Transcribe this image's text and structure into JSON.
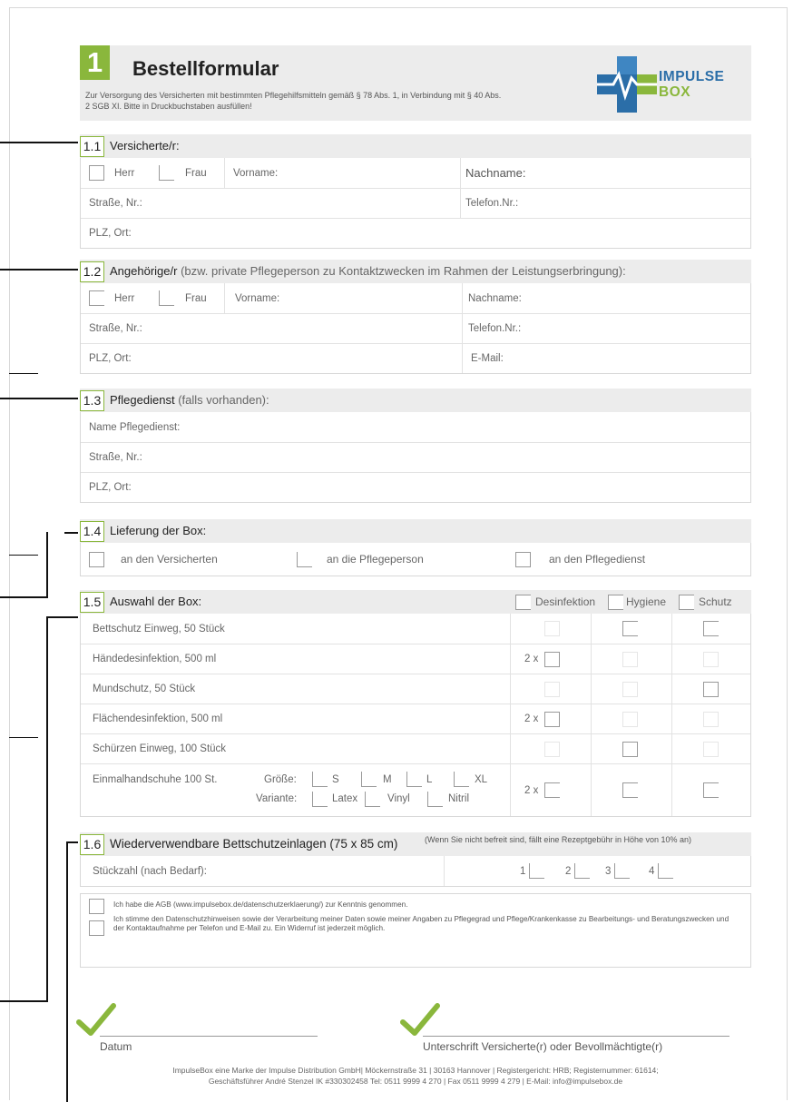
{
  "header": {
    "number": "1",
    "title": "Bestellformular",
    "description": "Zur Versorgung des Versicherten mit bestimmten Pflegehilfsmitteln gemäß § 78 Abs. 1, in Verbindung mit § 40 Abs. 2 SGB XI. Bitte in Druckbuchstaben ausfüllen!",
    "logo_line1": "IMPULSE",
    "logo_line2": "BOX"
  },
  "s11": {
    "num": "1.1",
    "title": "Versicherte/r:",
    "herr": "Herr",
    "frau": "Frau",
    "vorname": "Vorname:",
    "nachname": "Nachname:",
    "strasse": "Straße, Nr.:",
    "telefon": "Telefon.Nr.:",
    "plz": "PLZ, Ort:"
  },
  "s12": {
    "num": "1.2",
    "title": "Angehörige/r",
    "title_note": "(bzw. private Pflegeperson zu Kontaktzwecken im Rahmen der Leistungserbringung):",
    "herr": "Herr",
    "frau": "Frau",
    "vorname": "Vorname:",
    "nachname": "Nachname:",
    "strasse": "Straße, Nr.:",
    "telefon": "Telefon.Nr.:",
    "plz": "PLZ, Ort:",
    "email": "E-Mail:"
  },
  "s13": {
    "num": "1.3",
    "title": "Pflegedienst",
    "title_note": "(falls vorhanden):",
    "name": "Name Pflegedienst:",
    "strasse": "Straße, Nr.:",
    "plz": "PLZ, Ort:"
  },
  "s14": {
    "num": "1.4",
    "title": "Lieferung der Box:",
    "opt1": "an den Versicherten",
    "opt2": "an die Pflegeperson",
    "opt3": "an den Pflegedienst"
  },
  "s15": {
    "num": "1.5",
    "title": "Auswahl der Box:",
    "col1": "Desinfektion",
    "col2": "Hygiene",
    "col3": "Schutz",
    "items": [
      {
        "name": "Bettschutz Einweg, 50 Stück",
        "qty": ""
      },
      {
        "name": "Händedesinfektion, 500 ml",
        "qty": "2 x"
      },
      {
        "name": "Mundschutz, 50 Stück",
        "qty": ""
      },
      {
        "name": "Flächendesinfektion, 500 ml",
        "qty": "2 x"
      },
      {
        "name": "Schürzen Einweg, 100 Stück",
        "qty": ""
      }
    ],
    "gloves": {
      "name": "Einmalhandschuhe 100 St.",
      "size_label": "Größe:",
      "variant_label": "Variante:",
      "sizes": [
        "S",
        "M",
        "L",
        "XL"
      ],
      "variants": [
        "Latex",
        "Vinyl",
        "Nitril"
      ],
      "qty": "2 x"
    }
  },
  "s16": {
    "num": "1.6",
    "title": "Wiederverwendbare Bettschutzeinlagen (75 x 85 cm)",
    "note": "(Wenn Sie nicht befreit sind, fällt eine Rezeptgebühr in Höhe von 10% an)",
    "count_label": "Stückzahl (nach Bedarf):",
    "counts": [
      "1",
      "2",
      "3",
      "4"
    ]
  },
  "consent": {
    "agb": "Ich habe die AGB (www.impulsebox.de/datenschutzerklaerung/) zur Kenntnis genommen.",
    "privacy": "Ich stimme den Datenschutzhinweisen sowie der Verarbeitung meiner Daten sowie meiner Angaben zu Pflegegrad und Pflege/Krankenkasse zu Bearbeitungs- und Beratungszwecken und der Kontaktaufnahme per Telefon und E-Mail zu. Ein Widerruf ist jederzeit möglich."
  },
  "signature": {
    "datum": "Datum",
    "unterschrift": "Unterschrift Versicherte(r) oder Bevollmächtigte(r)"
  },
  "footer": {
    "line1": "ImpulseBox eine Marke der Impulse Distribution GmbH| Möckernstraße 31 | 30163 Hannover | Registergericht: HRB; Registernummer: 61614;",
    "line2": "Geschäftsführer André Stenzel IK #330302458 Tel: 0511 9999 4 270 | Fax 0511 9999 4 279 | E-Mail: info@impulsebox.de"
  },
  "colors": {
    "accent_green": "#8ab73c",
    "logo_blue": "#2b6ea8",
    "header_gray": "#ececec"
  }
}
